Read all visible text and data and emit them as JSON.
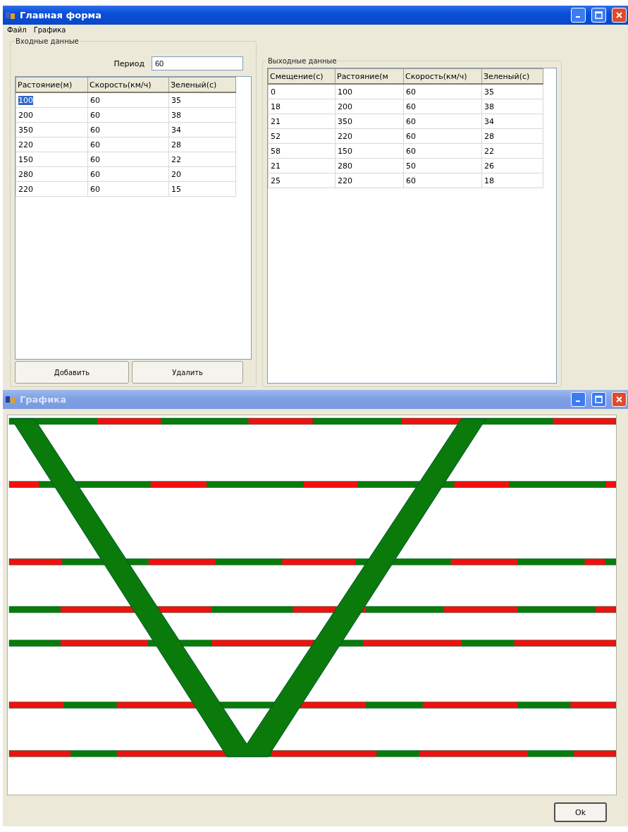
{
  "main_window": {
    "title": "Главная форма",
    "menu": [
      "Файл",
      "Графика"
    ],
    "input_group": {
      "title": "Входные данные",
      "period_label": "Период",
      "period_value": "60",
      "columns": [
        "Растояние(м)",
        "Скорость(км/ч)",
        "Зеленый(с)"
      ],
      "rows": [
        {
          "cells": [
            "100",
            "60",
            "35"
          ],
          "selected": true
        },
        {
          "cells": [
            "200",
            "60",
            "38"
          ],
          "selected": false
        },
        {
          "cells": [
            "350",
            "60",
            "34"
          ],
          "selected": false
        },
        {
          "cells": [
            "220",
            "60",
            "28"
          ],
          "selected": false
        },
        {
          "cells": [
            "150",
            "60",
            "22"
          ],
          "selected": false
        },
        {
          "cells": [
            "280",
            "60",
            "20"
          ],
          "selected": false
        },
        {
          "cells": [
            "220",
            "60",
            "15"
          ],
          "selected": false
        }
      ],
      "buttons": [
        "Добавить",
        "Удалить"
      ]
    },
    "output_group": {
      "title": "Выходные данные",
      "columns": [
        "Смещение(с)",
        "Растояние(м",
        "Скорость(км/ч)",
        "Зеленый(с)"
      ],
      "rows": [
        [
          "0",
          "100",
          "60",
          "35"
        ],
        [
          "18",
          "200",
          "60",
          "38"
        ],
        [
          "21",
          "350",
          "60",
          "34"
        ],
        [
          "52",
          "220",
          "60",
          "28"
        ],
        [
          "58",
          "150",
          "60",
          "22"
        ],
        [
          "21",
          "280",
          "50",
          "26"
        ],
        [
          "25",
          "220",
          "60",
          "18"
        ]
      ]
    }
  },
  "graph_window": {
    "title": "Графика",
    "button": "Ok"
  }
}
